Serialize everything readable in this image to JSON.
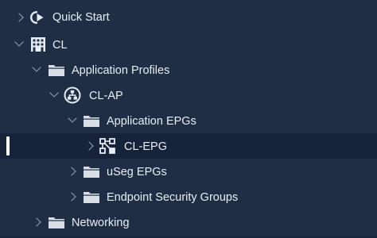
{
  "tree": {
    "items": [
      {
        "label": "Quick Start",
        "icon": "quick-start-icon",
        "expanded": false
      },
      {
        "label": "CL",
        "icon": "tenant-building-icon",
        "expanded": true
      },
      {
        "label": "Application Profiles",
        "icon": "folder-icon",
        "expanded": true
      },
      {
        "label": "CL-AP",
        "icon": "application-profile-icon",
        "expanded": true
      },
      {
        "label": "Application EPGs",
        "icon": "folder-icon",
        "expanded": true
      },
      {
        "label": "CL-EPG",
        "icon": "epg-icon",
        "expanded": false,
        "selected": true
      },
      {
        "label": "uSeg EPGs",
        "icon": "folder-icon",
        "expanded": false
      },
      {
        "label": "Endpoint Security Groups",
        "icon": "folder-icon",
        "expanded": false
      },
      {
        "label": "Networking",
        "icon": "folder-icon",
        "expanded": false
      }
    ]
  },
  "colors": {
    "background": "#1f2e45",
    "selected_row": "#17233a",
    "text": "#e8edf5",
    "chevron": "#9aa6b8",
    "folder": "#d9dee6",
    "selection_bar": "#ffffff"
  }
}
